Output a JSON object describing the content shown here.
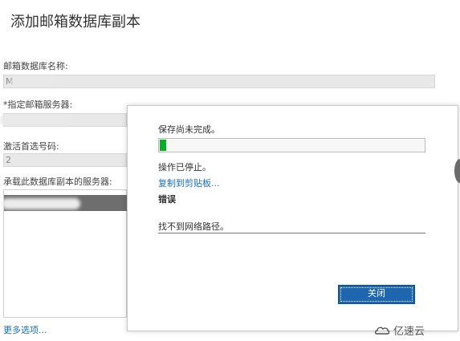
{
  "page": {
    "title": "添加邮箱数据库副本",
    "db_name_label": "邮箱数据库名称:",
    "db_name_value": "M",
    "server_label": "*指定邮箱服务器:",
    "activation_label": "激活首选号码:",
    "activation_value": "2",
    "hosting_servers_label": "承载此数据库副本的服务器:",
    "more_options": "更多选项..."
  },
  "dialog": {
    "status": "保存尚未完成。",
    "progress_fraction": 0.024,
    "stopped": "操作已停止。",
    "copy_link": "复制到剪贴板...",
    "error_heading": "错误",
    "error_message": "找不到网络路径。",
    "close_button": "关闭"
  },
  "watermark": {
    "text": "亿速云"
  },
  "colors": {
    "accent": "#1e67b0",
    "link": "#1a6fb5",
    "progress": "#06b025"
  }
}
